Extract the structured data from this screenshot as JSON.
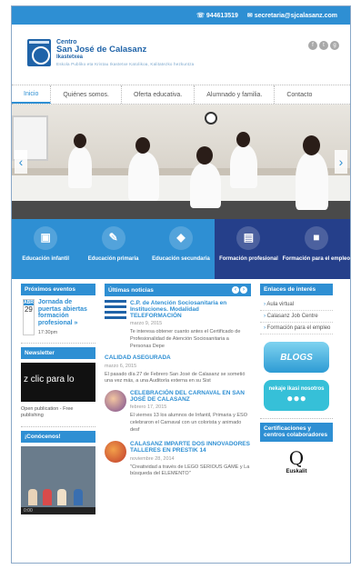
{
  "topbar": {
    "phone": "☏ 944613519",
    "email": "✉ secretaria@sjcalasanz.com"
  },
  "brand": {
    "line1": "Centro",
    "line2": "San José de Calasanz",
    "line3": "Ikastetxea",
    "line4": "Eskola Publiko eta Kristau Ikastetxe Katolikoa, Kalitatezko hezkuntza"
  },
  "social": [
    "f",
    "t",
    "g"
  ],
  "nav": [
    "Inicio",
    "Quiénes somos.",
    "Oferta educativa.",
    "Alumnado y familia.",
    "Contacto"
  ],
  "tiles": [
    {
      "label": "Educación infantil",
      "icon": "▣"
    },
    {
      "label": "Educación primaria",
      "icon": "✎"
    },
    {
      "label": "Educación secundaria",
      "icon": "◆"
    },
    {
      "label": "Formación profesional",
      "icon": "▤"
    },
    {
      "label": "Formación para el empleo",
      "icon": "■"
    }
  ],
  "events": {
    "title": "Próximos eventos",
    "month": "ABR",
    "day": "29",
    "event_title": "Jornada de puertas abiertas formación profesional »",
    "time": "17:30pm"
  },
  "newsletter": {
    "title": "Newsletter",
    "video_text": "z clic para lo",
    "caption": "Open publication - Free publishing"
  },
  "conocenos": {
    "title": "¡Conócenos!",
    "player_time": "0:00"
  },
  "news": {
    "title": "Últimas noticias",
    "prev": "‹",
    "next": "›",
    "items": [
      {
        "title": "C.P. de Atención Sociosanitaria en Instituciones. Modalidad TELEFORMACIÓN",
        "date": "marzo 9, 2015",
        "text": "Te interesa obtener cuanto antes el Certificado de Profesionalidad de Atención Sociosanitaria a Personas Depe"
      },
      {
        "title": "CALIDAD ASEGURADA",
        "date": "marzo 6, 2015",
        "text": "El pasado día 27 de Febrero San José de Calasanz se sometió una vez más, a una Auditoría externa en su Sist"
      },
      {
        "title": "CELEBRACIÓN DEL CARNAVAL EN SAN JOSÉ DE CALASANZ",
        "date": "febrero 17, 2015",
        "text": "El viernes 13 los alumnos de Infantil, Primaria y ESO celebraron el Carnaval con un colorista y animado desf"
      },
      {
        "title": "CALASANZ IMPARTE DOS INNOVADORES TALLERES EN PRESTIK 14",
        "date": "noviembre 28, 2014",
        "text": "\"Creatividad a través de LEGO SERIOUS GAME y La búsqueda del ELEMENTO\""
      }
    ]
  },
  "links": {
    "title": "Enlaces de interés",
    "items": [
      "Aula virtual",
      "Calasanz Job Centre",
      "Formación para el empleo"
    ]
  },
  "banners": {
    "blogs": "BLOGS",
    "blogs_sub": "del colegio",
    "ni": "nekaje ikasi nosotros"
  },
  "certs": {
    "title": "Certificaciones y centros colaboradores",
    "partner_logo": "Q",
    "partner_name": "Euskalit"
  },
  "colors": {
    "accent": "#2e8fd3",
    "dark_tile": "#253f8a"
  }
}
